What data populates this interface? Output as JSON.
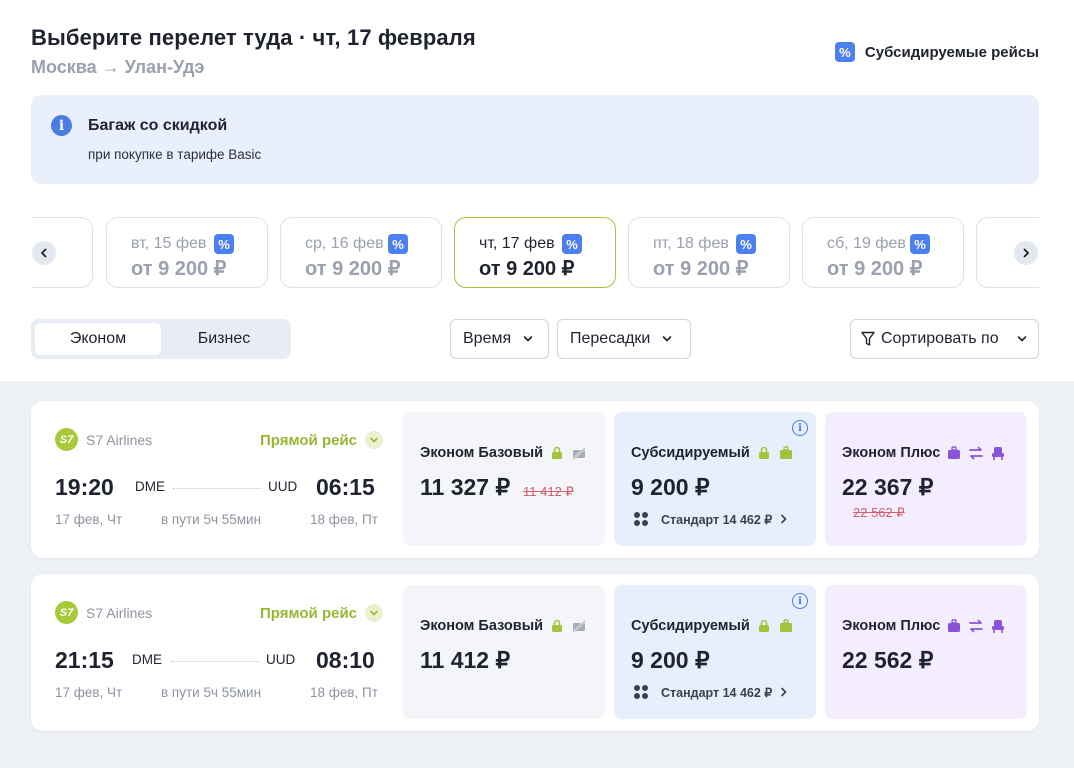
{
  "header": {
    "title": "Выберите перелет туда · чт, 17 февраля",
    "route": "Москва → Улан-Удэ",
    "subsidized_label": "Субсидируемые рейсы",
    "pct_symbol": "%"
  },
  "banner": {
    "info_symbol": "i",
    "title": "Багаж со скидкой",
    "text": "при покупке в тарифе Basic"
  },
  "dates": [
    {
      "label": "вт, 15 фев",
      "price": "от 9 200 ₽",
      "active": false
    },
    {
      "label": "ср, 16 фев",
      "price": "от 9 200 ₽",
      "active": false
    },
    {
      "label": "чт, 17 фев",
      "price": "от 9 200 ₽",
      "active": true
    },
    {
      "label": "пт, 18 фев",
      "price": "от 9 200 ₽",
      "active": false
    },
    {
      "label": "сб, 19 фев",
      "price": "от 9 200 ₽",
      "active": false
    }
  ],
  "cabin": {
    "economy": "Эконом",
    "business": "Бизнес",
    "selected": "Эконом"
  },
  "filters": {
    "time": "Время",
    "transfers": "Пересадки",
    "sort": "Сортировать по"
  },
  "flights": [
    {
      "airline": "S7 Airlines",
      "logo_text": "S7",
      "direct": "Прямой рейс",
      "dep_time": "19:20",
      "dep_airport": "DME",
      "dep_date": "17 фев, Чт",
      "arr_time": "06:15",
      "arr_airport": "UUD",
      "arr_date": "18 фев, Пт",
      "duration": "в пути 5ч 55мин",
      "fares": {
        "base": {
          "name": "Эконом Базовый",
          "price": "11 327 ₽",
          "old_price": "11 412 ₽"
        },
        "sub": {
          "name": "Субсидируемый",
          "price": "9 200 ₽",
          "standard": "Стандарт 14 462 ₽"
        },
        "plus": {
          "name": "Эконом Плюс",
          "price": "22 367 ₽",
          "old_price": "22 562 ₽"
        }
      }
    },
    {
      "airline": "S7 Airlines",
      "logo_text": "S7",
      "direct": "Прямой рейс",
      "dep_time": "21:15",
      "dep_airport": "DME",
      "dep_date": "17 фев, Чт",
      "arr_time": "08:10",
      "arr_airport": "UUD",
      "arr_date": "18 фев, Пт",
      "duration": "в пути 5ч 55мин",
      "fares": {
        "base": {
          "name": "Эконом Базовый",
          "price": "11 412 ₽"
        },
        "sub": {
          "name": "Субсидируемый",
          "price": "9 200 ₽",
          "standard": "Стандарт 14 462 ₽"
        },
        "plus": {
          "name": "Эконом Плюс",
          "price": "22 562 ₽"
        }
      }
    }
  ],
  "colors": {
    "accent_green": "#a3c43a",
    "pct_blue": "#4c7ff0",
    "baggage_green": "#a5c33a",
    "plus_purple": "#8b54d6"
  },
  "icons": [
    "chevron-left-icon",
    "chevron-right-icon",
    "filter-icon",
    "chevron-down-icon",
    "info-icon",
    "baggage-icon",
    "no-baggage-icon",
    "exchange-icon",
    "seat-icon",
    "seatmap-icon"
  ]
}
